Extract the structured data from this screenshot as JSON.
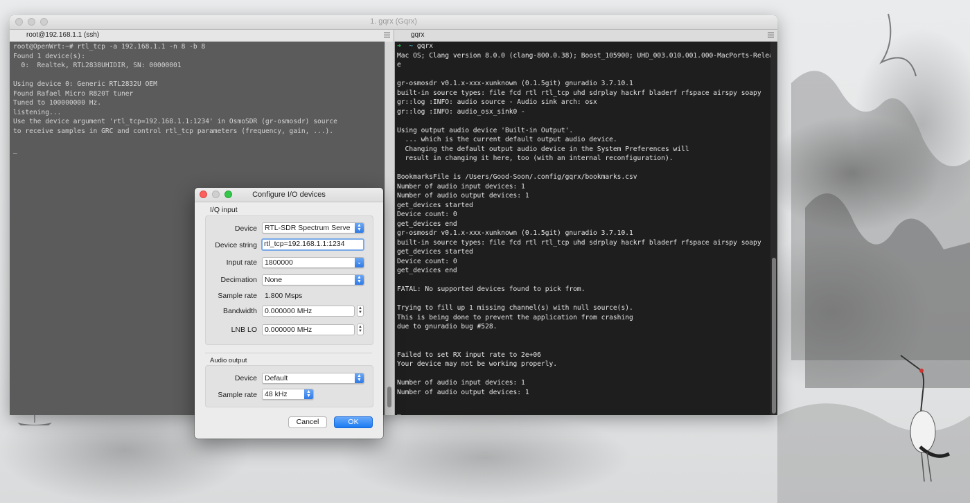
{
  "window": {
    "title": "1. gqrx (Gqrx)",
    "tabs": [
      {
        "label": "root@192.168.1.1 (ssh)"
      },
      {
        "label": "gqrx"
      }
    ]
  },
  "left_terminal": {
    "lines": [
      "root@OpenWrt:~# rtl_tcp -a 192.168.1.1 -n 8 -b 8",
      "Found 1 device(s):",
      "  0:  Realtek, RTL2838UHIDIR, SN: 00000001",
      "",
      "Using device 0: Generic RTL2832U OEM",
      "Found Rafael Micro R820T tuner",
      "Tuned to 100000000 Hz.",
      "listening...",
      "Use the device argument 'rtl_tcp=192.168.1.1:1234' in OsmoSDR (gr-osmosdr) source",
      "to receive samples in GRC and control rtl_tcp parameters (frequency, gain, ...).",
      "",
      "_"
    ]
  },
  "right_terminal": {
    "prompt_arrow": "➜",
    "prompt_dir": "~",
    "command": "gqrx",
    "lines": [
      "Mac OS; Clang version 8.0.0 (clang-800.0.38); Boost_105900; UHD_003.010.001.000-MacPorts-Releas",
      "e",
      "",
      "gr-osmosdr v0.1.x-xxx-xunknown (0.1.5git) gnuradio 3.7.10.1",
      "built-in source types: file fcd rtl rtl_tcp uhd sdrplay hackrf bladerf rfspace airspy soapy",
      "gr::log :INFO: audio source - Audio sink arch: osx",
      "gr::log :INFO: audio_osx_sink0 -",
      "",
      "Using output audio device 'Built-in Output'.",
      "  ... which is the current default output audio device.",
      "  Changing the default output audio device in the System Preferences will",
      "  result in changing it here, too (with an internal reconfiguration).",
      "",
      "BookmarksFile is /Users/Good-Soon/.config/gqrx/bookmarks.csv",
      "Number of audio input devices: 1",
      "Number of audio output devices: 1",
      "get_devices started",
      "Device count: 0",
      "get_devices end",
      "gr-osmosdr v0.1.x-xxx-xunknown (0.1.5git) gnuradio 3.7.10.1",
      "built-in source types: file fcd rtl rtl_tcp uhd sdrplay hackrf bladerf rfspace airspy soapy",
      "get_devices started",
      "Device count: 0",
      "get_devices end",
      "",
      "FATAL: No supported devices found to pick from.",
      "",
      "Trying to fill up 1 missing channel(s) with null source(s).",
      "This is being done to prevent the application from crashing",
      "due to gnuradio bug #528.",
      "",
      "",
      "Failed to set RX input rate to 2e+06",
      "Your device may not be working properly.",
      "",
      "Number of audio input devices: 1",
      "Number of audio output devices: 1",
      "",
      "_"
    ]
  },
  "dialog": {
    "title": "Configure I/O devices",
    "iq_input": {
      "section_label": "I/Q input",
      "device_label": "Device",
      "device_value": "RTL-SDR Spectrum Serve",
      "device_string_label": "Device string",
      "device_string_value": "rtl_tcp=192.168.1.1:1234",
      "input_rate_label": "Input rate",
      "input_rate_value": "1800000",
      "decimation_label": "Decimation",
      "decimation_value": "None",
      "sample_rate_label": "Sample rate",
      "sample_rate_value": "1.800 Msps",
      "bandwidth_label": "Bandwidth",
      "bandwidth_value": "0.000000 MHz",
      "lnb_lo_label": "LNB LO",
      "lnb_lo_value": "0.000000 MHz"
    },
    "audio_output": {
      "section_label": "Audio output",
      "device_label": "Device",
      "device_value": "Default",
      "sample_rate_label": "Sample rate",
      "sample_rate_value": "48 kHz"
    },
    "cancel_label": "Cancel",
    "ok_label": "OK"
  }
}
